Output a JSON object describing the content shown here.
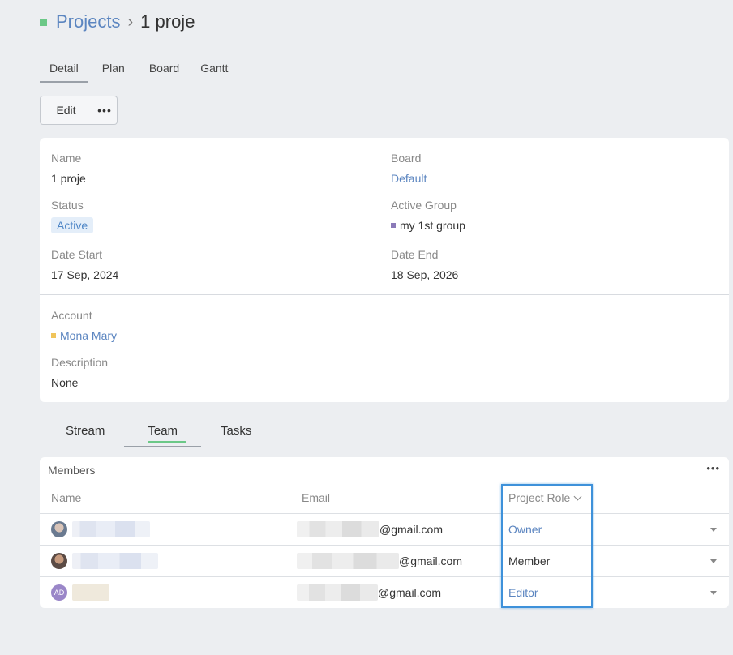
{
  "breadcrumb": {
    "parent": "Projects",
    "separator": "›",
    "current": "1 proje"
  },
  "top_tabs": [
    {
      "label": "Detail",
      "active": true
    },
    {
      "label": "Plan",
      "active": false
    },
    {
      "label": "Board",
      "active": false
    },
    {
      "label": "Gantt",
      "active": false
    }
  ],
  "toolbar": {
    "edit_label": "Edit",
    "more_label": "•••"
  },
  "details": {
    "name_label": "Name",
    "name_value": "1 proje",
    "board_label": "Board",
    "board_value": "Default",
    "status_label": "Status",
    "status_value": "Active",
    "active_group_label": "Active Group",
    "active_group_value": "my 1st group",
    "date_start_label": "Date Start",
    "date_start_value": "17 Sep, 2024",
    "date_end_label": "Date End",
    "date_end_value": "18 Sep, 2026",
    "account_label": "Account",
    "account_value": "Mona Mary",
    "description_label": "Description",
    "description_value": "None"
  },
  "bottom_tabs": [
    {
      "label": "Stream",
      "active": false
    },
    {
      "label": "Team",
      "active": true
    },
    {
      "label": "Tasks",
      "active": false
    }
  ],
  "members": {
    "title": "Members",
    "menu_label": "•••",
    "columns": {
      "name": "Name",
      "email": "Email",
      "role": "Project Role"
    },
    "rows": [
      {
        "avatar": "",
        "email_suffix": "@gmail.com",
        "role": "Owner"
      },
      {
        "avatar": "",
        "email_suffix": "@gmail.com",
        "role": "Member"
      },
      {
        "avatar": "AD",
        "email_suffix": "@gmail.com",
        "role": "Editor"
      }
    ]
  },
  "colors": {
    "accent": "#5b85c0",
    "header_square": "#6bc887",
    "highlight": "#3e91da",
    "group_dot": "#8b7ab8",
    "account_dot": "#f0c45a"
  }
}
